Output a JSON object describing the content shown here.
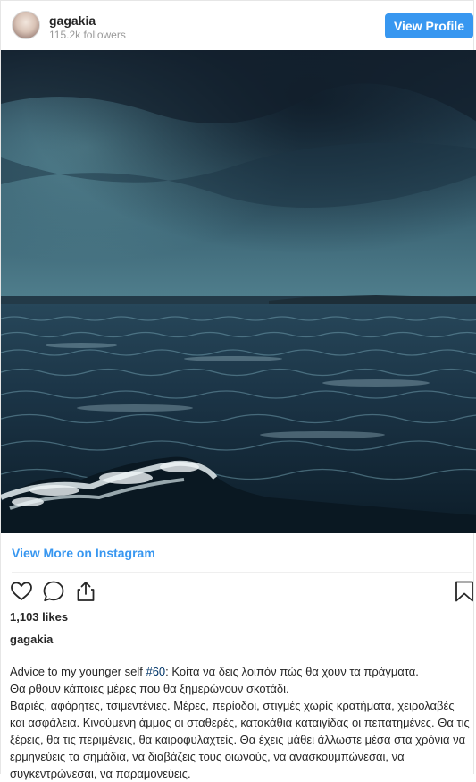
{
  "header": {
    "username": "gagakia",
    "followers": "115.2k followers",
    "view_profile_label": "View Profile"
  },
  "post": {
    "image_alt": "",
    "view_more_label": "View More on Instagram",
    "likes": "1,103 likes",
    "caption_user": "gagakia",
    "caption_intro": "Advice to my younger self ",
    "hashtag": "#60",
    "caption_rest": ": Κοίτα να δεις λοιπόν πώς θα χουν τα πράγματα.",
    "caption_line2": "Θα ρθουν κάποιες μέρες που θα ξημερώνουν σκοτάδι.",
    "caption_para2": "Βαριές, αφόρητες, τσιμεντένιες. Μέρες, περίοδοι, στιγμές χωρίς κρατήματα, χειρολαβές και ασφάλεια. Κινούμενη άμμος οι σταθερές, κατακάθια καταιγίδας οι πεπατημένες. Θα τις ξέρεις, θα τις περιμένεις, θα καιροφυλαχτείς. Θα έχεις μάθει άλλωστε μέσα στα χρόνια να ερμηνεύεις τα σημάδια, να διαβάζεις τους οιωνούς, να ανασκουμπώνεσαι, να συγκεντρώνεσαι, να παραμονεύεις."
  },
  "icons": {
    "like": "heart-icon",
    "comment": "comment-icon",
    "share": "share-icon",
    "save": "bookmark-icon"
  },
  "colors": {
    "accent": "#3897f0",
    "hashtag": "#003569"
  }
}
